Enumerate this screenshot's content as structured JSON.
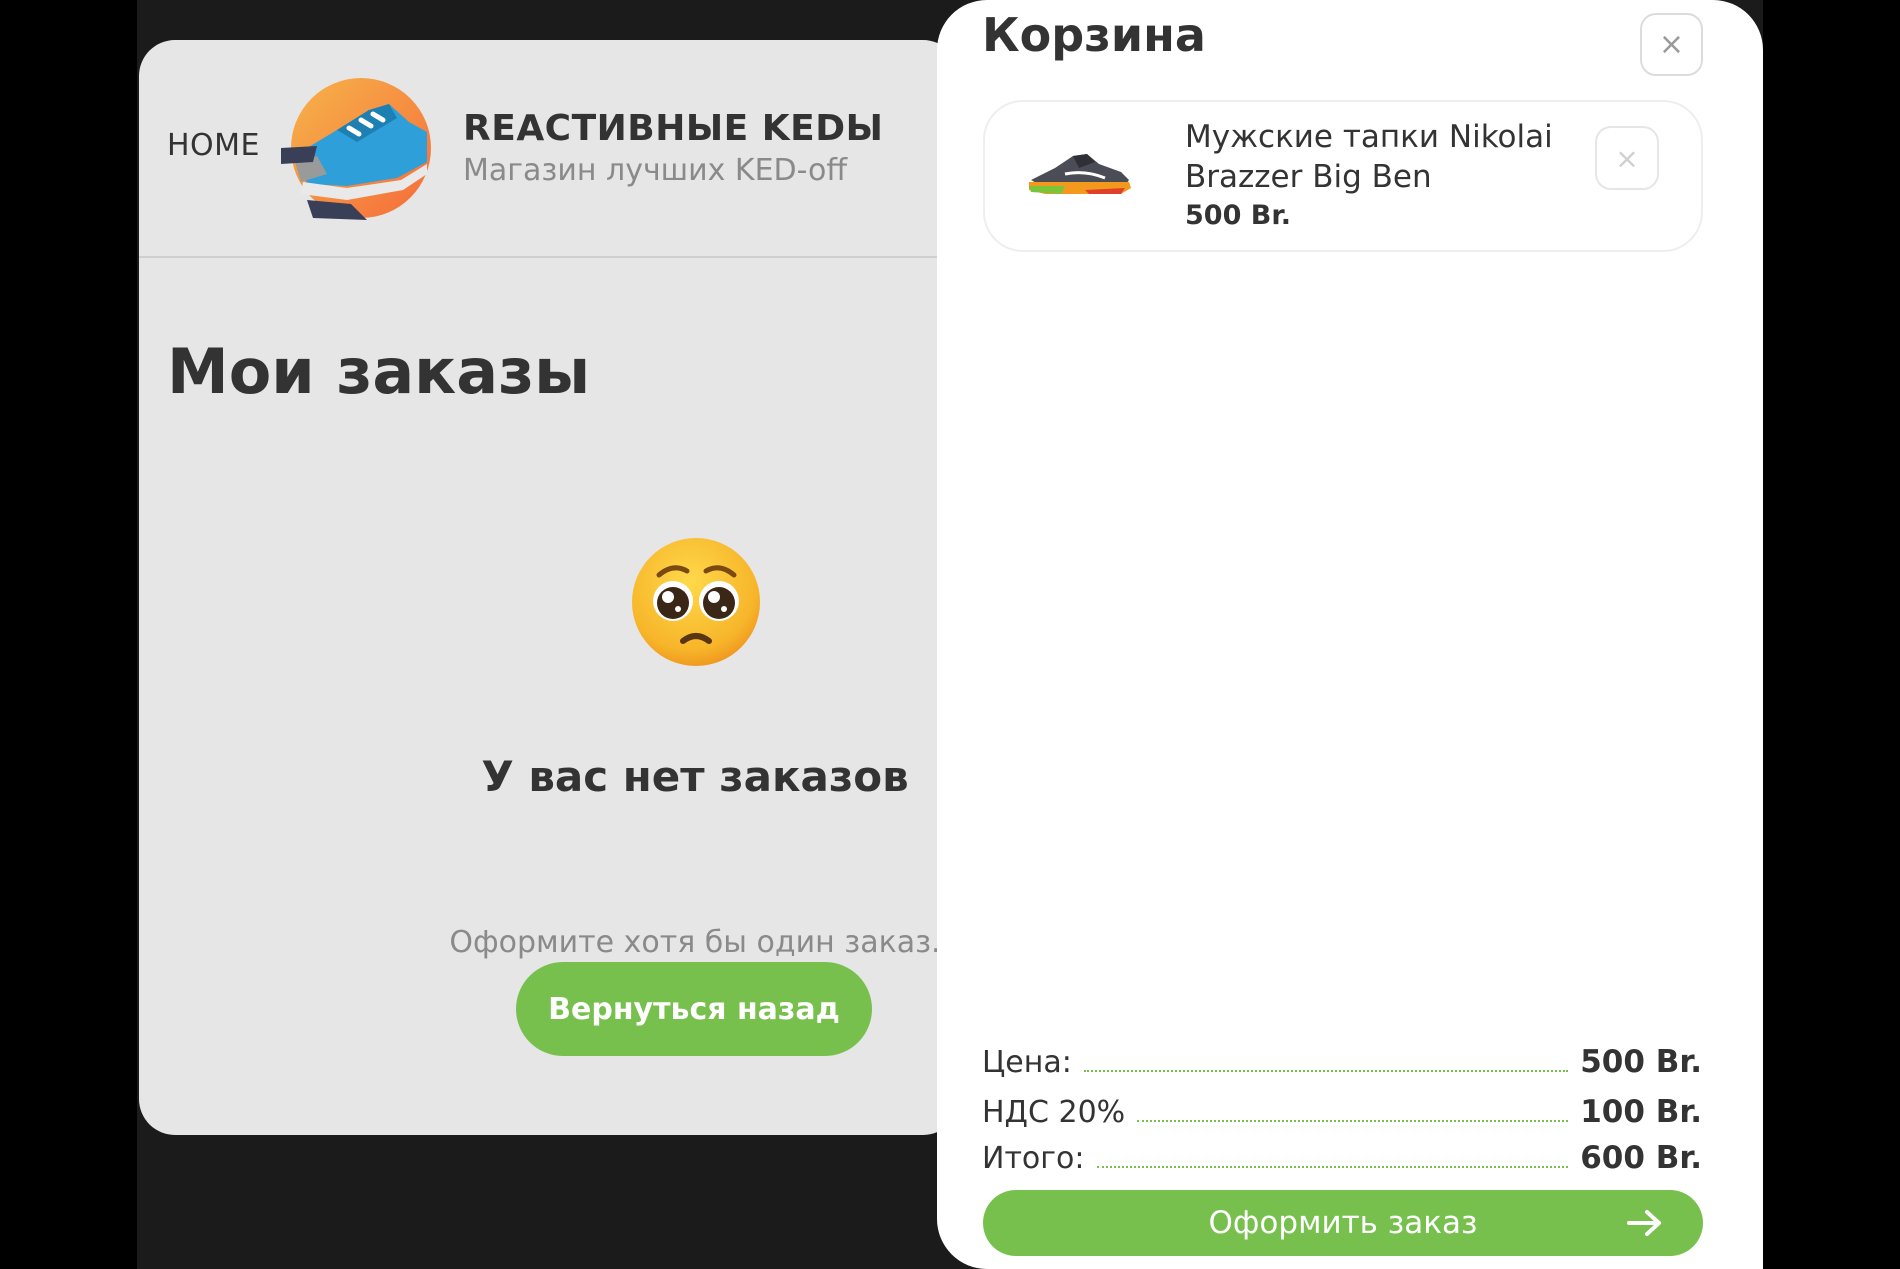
{
  "header": {
    "home_label": "HOME",
    "brand_title": "REACTИВНЫЕ KEDЫ",
    "brand_subtitle": "Магазин лучших KED-off",
    "logo_icon": "sneaker-logo-icon"
  },
  "main": {
    "title": "Мои заказы",
    "empty_emoji": "pleading-face-emoji",
    "empty_title": "У вас нет заказов",
    "empty_subtitle": "Оформите хотя бы один заказ.",
    "back_button": "Вернуться назад"
  },
  "cart": {
    "title": "Корзина",
    "close_icon": "×",
    "items": [
      {
        "name": "Мужские тапки Nikolai Brazzer Big Ben",
        "price": "500 Br.",
        "remove_icon": "×"
      }
    ],
    "summary": {
      "price_label": "Цена:",
      "price_value": "500 Br.",
      "vat_label": "НДС 20%",
      "vat_value": "100 Br.",
      "total_label": "Итого:",
      "total_value": "600 Br."
    },
    "checkout_button": "Оформить заказ"
  },
  "colors": {
    "accent_green": "#78c04e",
    "page_bg": "#e6e6e6",
    "dark_bg": "#1b1b1b",
    "text_dark": "#333333",
    "text_muted": "#8a8a8a"
  }
}
